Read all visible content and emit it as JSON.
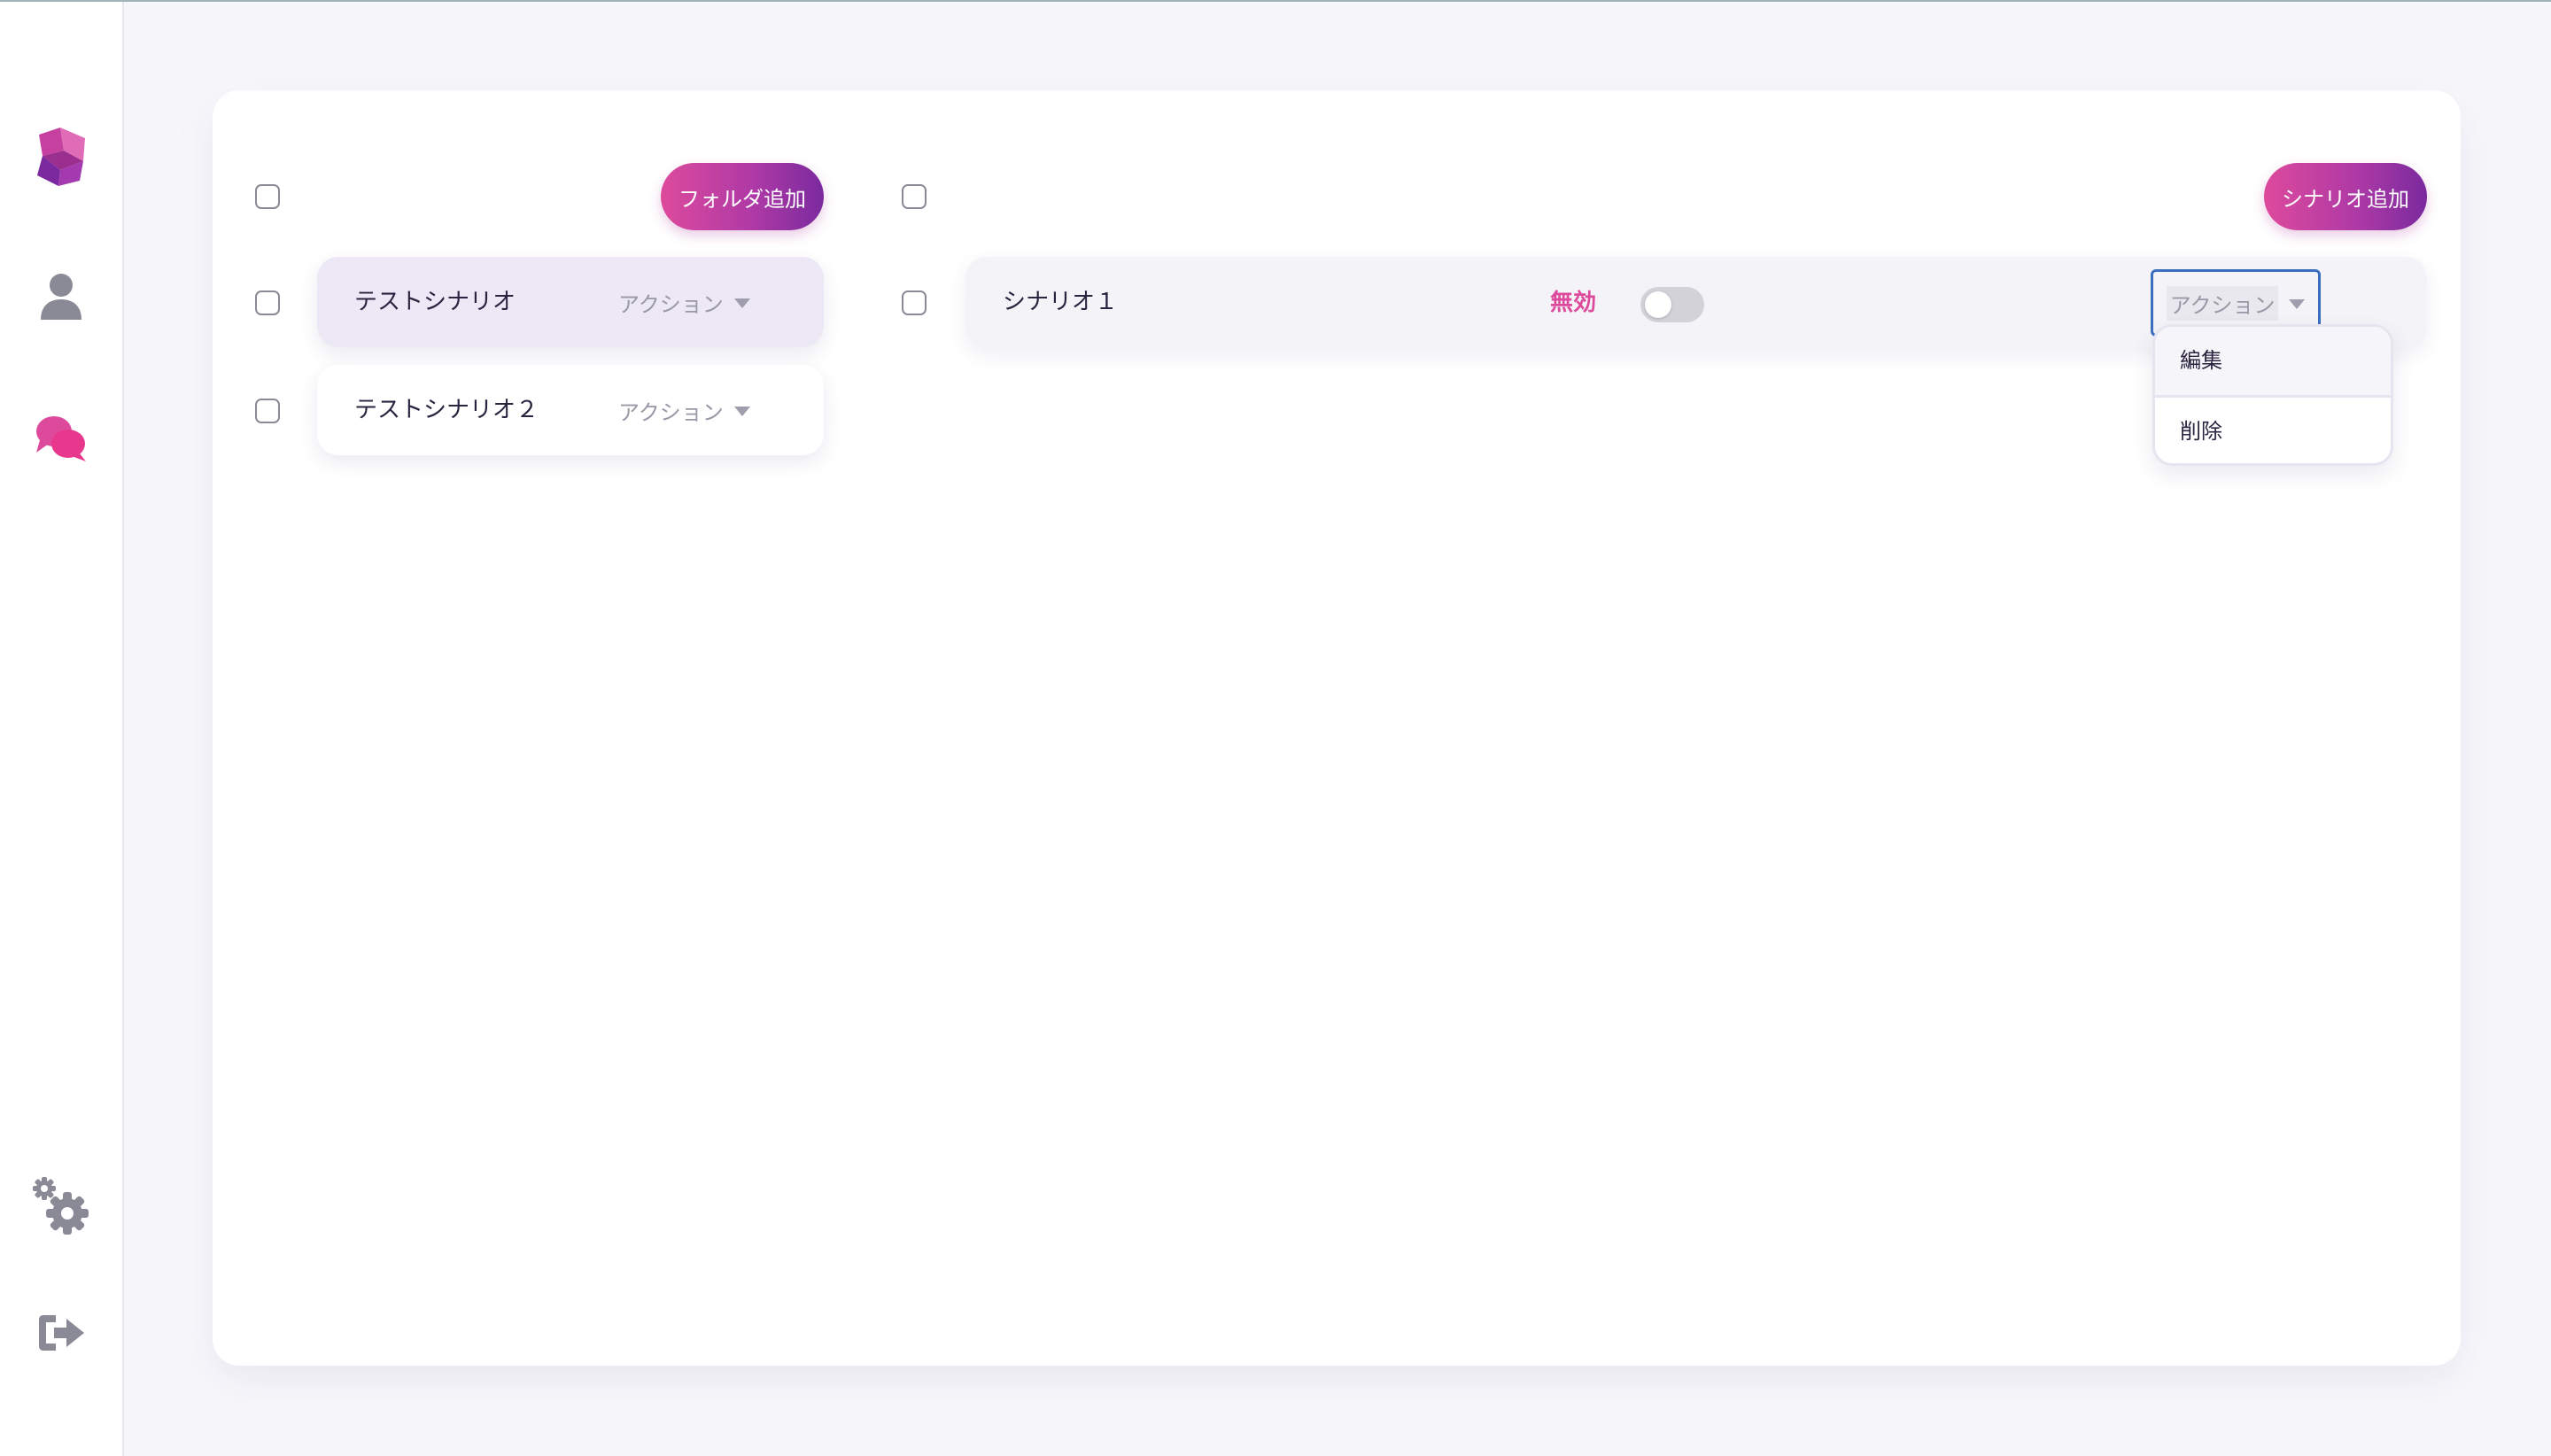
{
  "sidebar": {
    "icons": [
      "app-logo-icon",
      "user-icon",
      "chat-bubbles-icon",
      "gears-icon",
      "logout-icon"
    ],
    "colors": {
      "brand_pink": "#dd4a9c",
      "brand_purple": "#7a2a9e",
      "icon_gray": "#8a8a96"
    }
  },
  "folders": {
    "add_button_label": "フォルダ追加",
    "items": [
      {
        "name": "テストシナリオ",
        "action_label": "アクション",
        "selected": true
      },
      {
        "name": "テストシナリオ２",
        "action_label": "アクション",
        "selected": false
      }
    ]
  },
  "scenarios": {
    "add_button_label": "シナリオ追加",
    "items": [
      {
        "name": "シナリオ１",
        "status_label": "無効",
        "enabled": false,
        "action_label": "アクション"
      }
    ]
  },
  "dropdown": {
    "items": [
      "編集",
      "削除"
    ]
  }
}
